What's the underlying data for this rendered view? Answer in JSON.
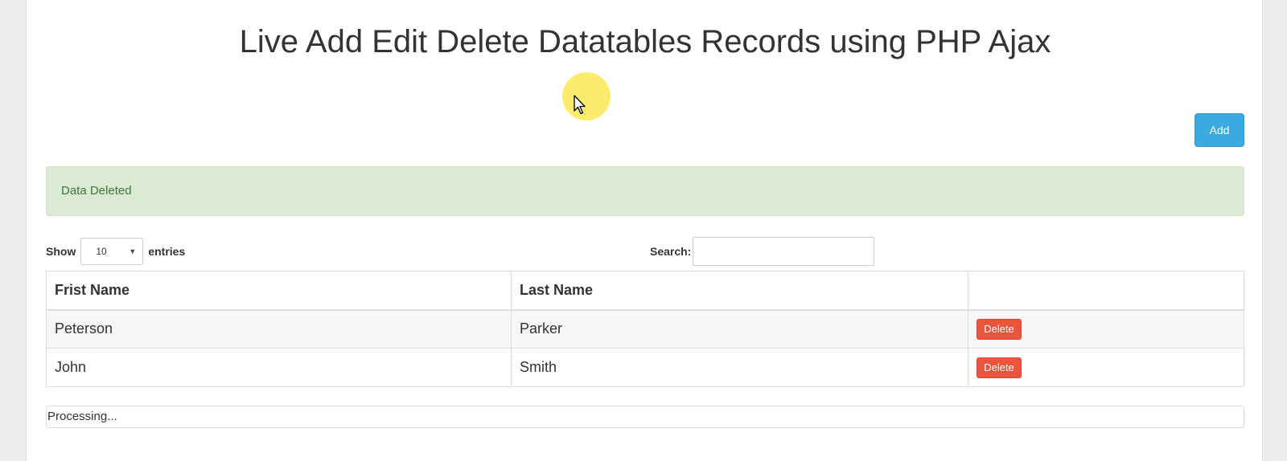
{
  "header": {
    "title": "Live Add Edit Delete Datatables Records using PHP Ajax"
  },
  "toolbar": {
    "add_label": "Add"
  },
  "alert": {
    "message": "Data Deleted"
  },
  "length": {
    "show_label": "Show",
    "selected": "10",
    "entries_label": "entries"
  },
  "search": {
    "label": "Search:",
    "value": ""
  },
  "table": {
    "columns": [
      "Frist Name",
      "Last Name",
      ""
    ],
    "rows": [
      {
        "first": "Peterson",
        "last": "Parker",
        "action": "Delete"
      },
      {
        "first": "John",
        "last": "Smith",
        "action": "Delete"
      }
    ]
  },
  "status": {
    "processing": "Processing..."
  },
  "colors": {
    "add_button": "#3aabe0",
    "delete_button": "#e9553d",
    "alert_background": "#dbead2",
    "cursor_highlight": "#fae63c"
  }
}
